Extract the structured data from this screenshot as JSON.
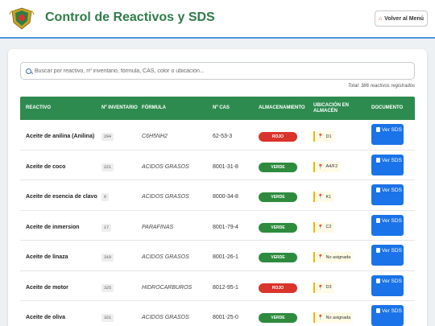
{
  "header": {
    "title": "Control de Reactivos y SDS",
    "back_label": "Volver al Menú"
  },
  "search": {
    "placeholder": "Buscar por reactivo, nº inventario, fórmula, CAS, color o ubicación..."
  },
  "total_text": "Total: 386 reactivos registrados",
  "table": {
    "headers": {
      "reactivo": "REACTIVO",
      "inventario": "Nº INVENTARIO",
      "formula": "FÓRMULA",
      "cas": "Nº CAS",
      "almacenamiento": "ALMACENAMIENTO",
      "ubicacion": "UBICACIÓN EN ALMACÉN",
      "documento": "DOCUMENTO"
    },
    "doc_button_label": "Ver SDS",
    "rows": [
      {
        "name": "Aceite de anilina (Anilina)",
        "inv": "294",
        "formula": "C6H5NH2",
        "cas": "62-53-3",
        "storage": "ROJO",
        "storage_color": "#d9342b",
        "location": "D1"
      },
      {
        "name": "Aceite de coco",
        "inv": "221",
        "formula": "ACIDOS GRASOS",
        "cas": "8001-31-8",
        "storage": "VERDE",
        "storage_color": "#2e8b3e",
        "location": "A4/F2"
      },
      {
        "name": "Aceite de esencia de clavo",
        "inv": "6",
        "formula": "ACIDOS GRASOS",
        "cas": "8000-34-8",
        "storage": "VERDE",
        "storage_color": "#2e8b3e",
        "location": "K1"
      },
      {
        "name": "Aceite de inmersion",
        "inv": "17",
        "formula": "PARAFINAS",
        "cas": "8001-79-4",
        "storage": "VERDE",
        "storage_color": "#2e8b3e",
        "location": "C2"
      },
      {
        "name": "Aceite de linaza",
        "inv": "319",
        "formula": "ACIDOS GRASOS",
        "cas": "8001-26-1",
        "storage": "VERDE",
        "storage_color": "#2e8b3e",
        "location": "No asignada"
      },
      {
        "name": "Aceite de motor",
        "inv": "325",
        "formula": "HIDROCARBUROS",
        "cas": "8012-95-1",
        "storage": "ROJO",
        "storage_color": "#d9342b",
        "location": "D3"
      },
      {
        "name": "Aceite de oliva",
        "inv": "321",
        "formula": "ACIDOS GRASOS",
        "cas": "8001-25-0",
        "storage": "VERDE",
        "storage_color": "#2e8b3e",
        "location": "No asignada"
      }
    ]
  }
}
